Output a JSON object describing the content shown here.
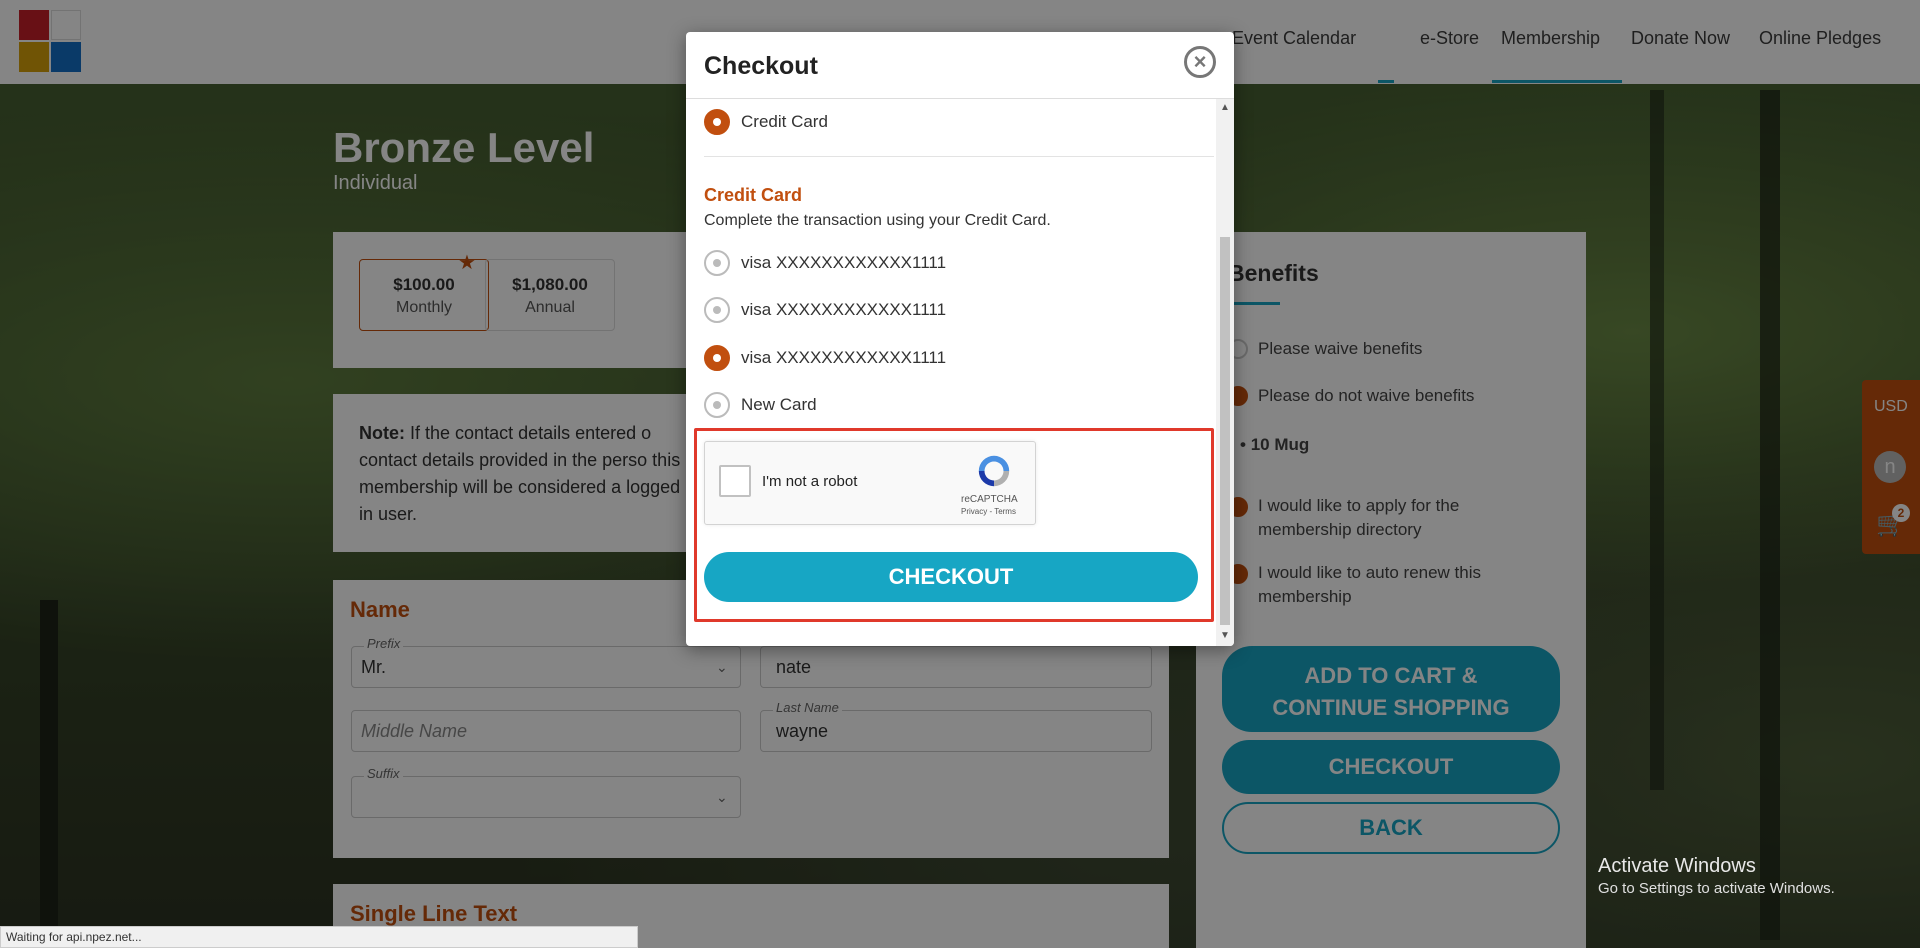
{
  "header": {
    "nav": [
      "Event Calendar",
      "e-Store",
      "Membership",
      "Donate Now",
      "Online Pledges"
    ],
    "logo_colors": [
      "#c81f2a",
      "#d6a10a",
      "#1570c8",
      "#ffffff"
    ]
  },
  "page": {
    "title": "Bronze Level",
    "subtitle": "Individual",
    "prices": [
      {
        "value": "$100.00",
        "period": "Monthly"
      },
      {
        "value": "$1,080.00",
        "period": "Annual"
      }
    ],
    "note_bold": "Note:",
    "note_text": "If the contact details entered o contact details provided in the perso this membership will be considered a logged in user.",
    "name_section": "Name",
    "prefix_label": "Prefix",
    "prefix_value": "Mr.",
    "first_name_value": "nate",
    "middle_name_placeholder": "Middle Name",
    "last_name_label": "Last Name",
    "last_name_value": "wayne",
    "suffix_label": "Suffix",
    "single_line_section": "Single Line Text"
  },
  "benefits": {
    "title": "Benefits",
    "options": [
      "Please waive benefits",
      "Please do not waive benefits"
    ],
    "benefit_item": "10 Mug",
    "directory": "I would like to apply for the membership directory",
    "auto_renew": "I would like to auto renew this membership",
    "add_to_cart_line1": "ADD TO CART &",
    "add_to_cart_line2": "CONTINUE SHOPPING",
    "checkout": "CHECKOUT",
    "back": "BACK"
  },
  "side": {
    "currency": "USD",
    "avatar_letter": "n",
    "cart_count": "2"
  },
  "modal": {
    "title": "Checkout",
    "payment_method": "Credit Card",
    "cc_title": "Credit Card",
    "cc_desc": "Complete the transaction using your Credit Card.",
    "cards": [
      "visa XXXXXXXXXXXX1111",
      "visa XXXXXXXXXXXX1111",
      "visa XXXXXXXXXXXX1111",
      "New Card"
    ],
    "selected_card_index": 2,
    "captcha_label": "I'm not a robot",
    "captcha_brand": "reCAPTCHA",
    "captcha_links": "Privacy - Terms",
    "checkout_button": "CHECKOUT"
  },
  "windows": {
    "activate_title": "Activate Windows",
    "activate_sub": "Go to Settings to activate Windows."
  },
  "status_bar": "Waiting for api.npez.net..."
}
